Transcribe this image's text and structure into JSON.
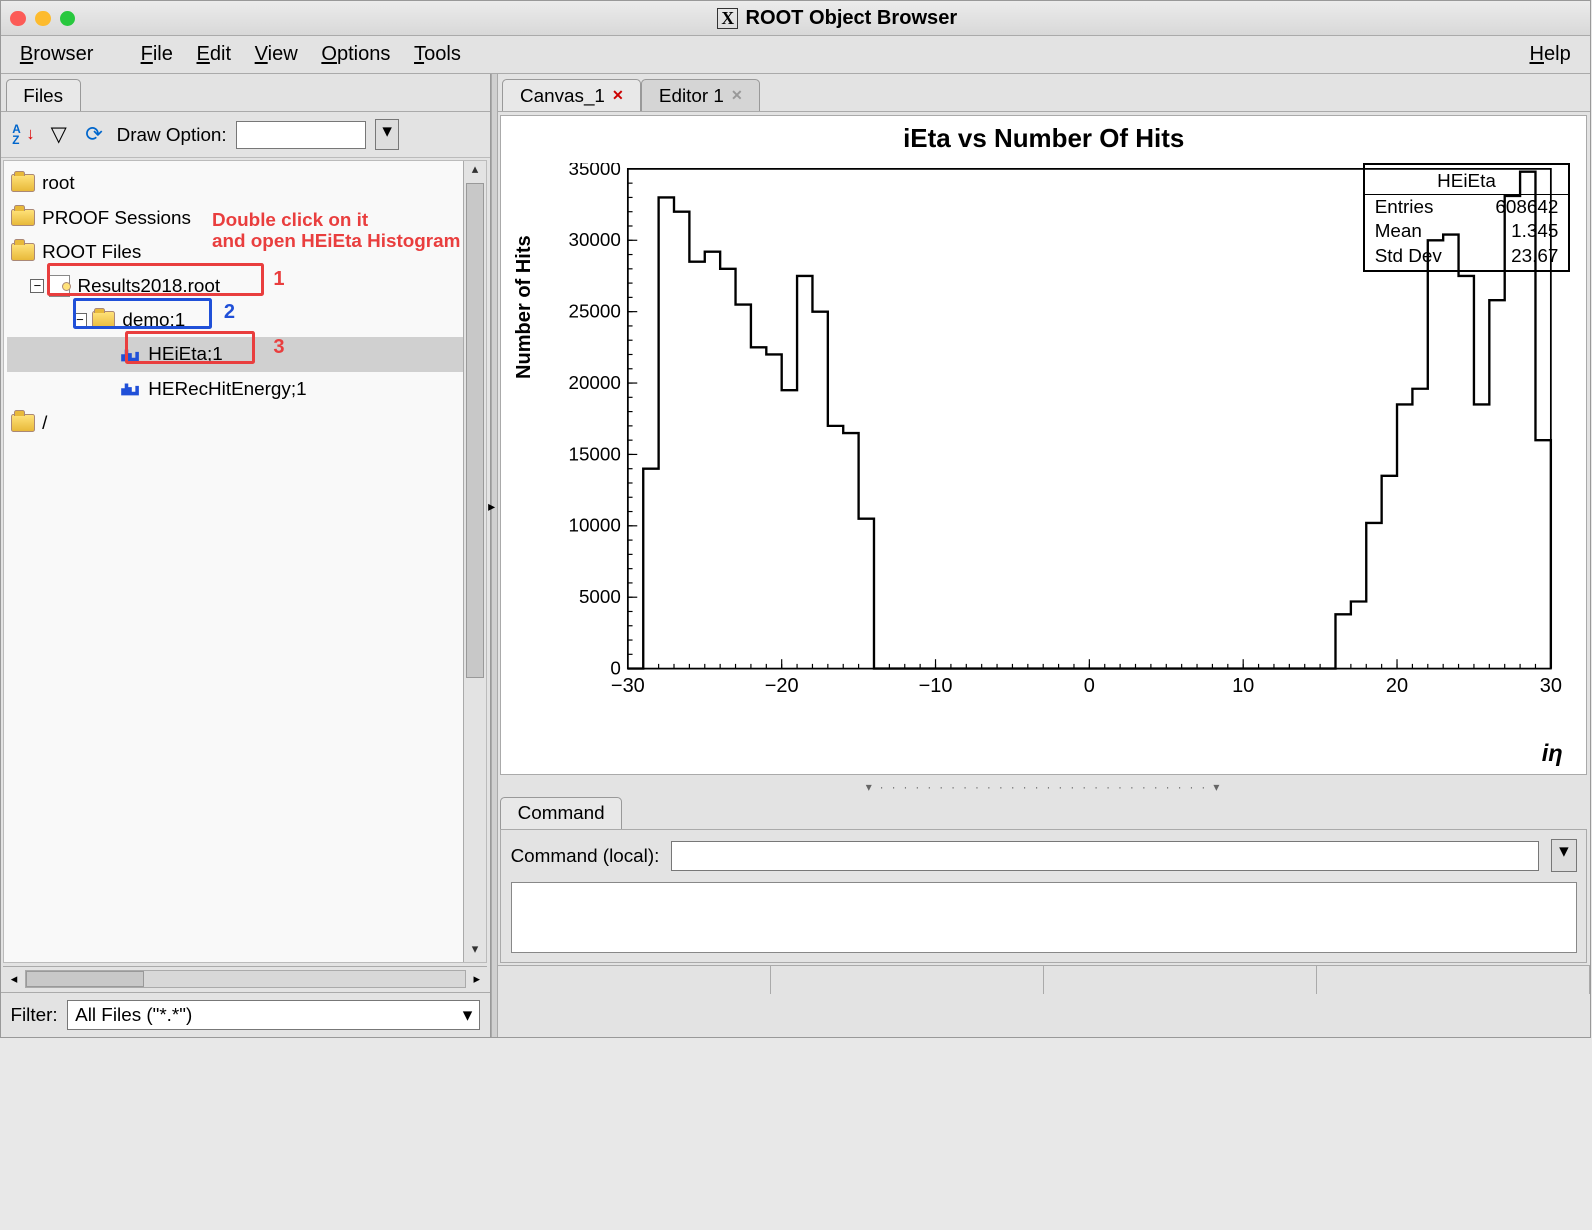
{
  "window": {
    "title": "ROOT Object Browser",
    "browser_label": "Browser"
  },
  "menu": {
    "file": "File",
    "edit": "Edit",
    "view": "View",
    "options": "Options",
    "tools": "Tools",
    "help": "Help"
  },
  "left": {
    "tab": "Files",
    "draw_option_label": "Draw Option:",
    "filter_label": "Filter:",
    "filter_value": "All Files (\"*.*\")",
    "tree": {
      "root": "root",
      "proof": "PROOF Sessions",
      "rootfiles": "ROOT Files",
      "results": "Results2018.root",
      "demo": "demo;1",
      "heieta": "HEiEta;1",
      "herec": "HERecHitEnergy;1",
      "slash": "/"
    }
  },
  "annotations": {
    "hint": "Double click on it\nand open HEiEta Histogram",
    "n1": "1",
    "n2": "2",
    "n3": "3"
  },
  "right": {
    "canvas_tab": "Canvas_1",
    "editor_tab": "Editor 1",
    "command_tab": "Command",
    "command_label": "Command (local):"
  },
  "chart_data": {
    "type": "bar",
    "title": "iEta vs Number Of Hits",
    "xlabel": "iη",
    "ylabel": "Number of Hits",
    "xlim": [
      -30,
      30
    ],
    "ylim": [
      0,
      35000
    ],
    "xticks": [
      -30,
      -20,
      -10,
      0,
      10,
      20,
      30
    ],
    "yticks": [
      0,
      5000,
      10000,
      15000,
      20000,
      25000,
      30000,
      35000
    ],
    "stats": {
      "name": "HEiEta",
      "entries_label": "Entries",
      "entries": 608642,
      "mean_label": "Mean",
      "mean": 1.345,
      "std_label": "Std Dev",
      "std": 23.67
    },
    "bin_width": 1,
    "x": [
      -29,
      -28,
      -27,
      -26,
      -25,
      -24,
      -23,
      -22,
      -21,
      -20,
      -19,
      -18,
      -17,
      -16,
      -15,
      16,
      17,
      18,
      19,
      20,
      21,
      22,
      23,
      24,
      25,
      26,
      27,
      28,
      29
    ],
    "values": [
      14000,
      33000,
      32000,
      28500,
      29200,
      28000,
      25500,
      22500,
      22000,
      19500,
      27500,
      25000,
      17000,
      16500,
      10500,
      3800,
      4700,
      10200,
      13500,
      18500,
      19600,
      30000,
      30400,
      27500,
      18500,
      25800,
      33100,
      34800,
      16000
    ]
  }
}
